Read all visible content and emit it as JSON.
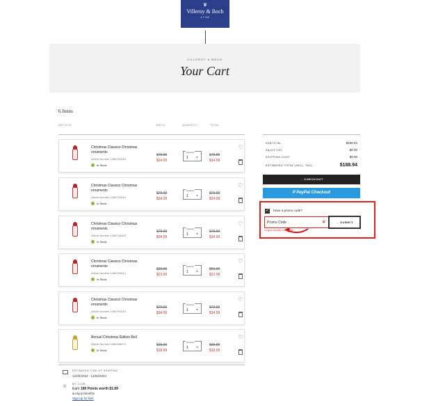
{
  "header": {
    "logo_top": "♛",
    "logo_name": "Villeroy & Boch",
    "logo_year": "1748",
    "hero_brand": "VILLEROY & BOCH",
    "hero_title": "Your Cart"
  },
  "cart": {
    "items_count": "6 Items",
    "columns": {
      "article": "ARTICLE",
      "each": "EACH",
      "quantity": "QUANTITY",
      "total": "TOTAL"
    },
    "qty_label": "Quantity",
    "items": [
      {
        "title": "Christmas Classics Christmas ornaments",
        "article": "Article Number 1486794340",
        "stock": "In Stock",
        "each_orig": "$79.99",
        "each_sale": "$34.99",
        "qty": "1",
        "total_orig": "$79.99",
        "total_sale": "$34.99"
      },
      {
        "title": "Christmas Classics Christmas ornaments",
        "article": "Article Number 1486794344",
        "stock": "In Stock",
        "each_orig": "$79.99",
        "each_sale": "$34.99",
        "qty": "1",
        "total_orig": "$79.99",
        "total_sale": "$34.99"
      },
      {
        "title": "Christmas Classics Christmas ornaments",
        "article": "Article Number 1486794343",
        "stock": "In Stock",
        "each_orig": "$79.99",
        "each_sale": "$34.99",
        "qty": "1",
        "total_orig": "$79.99",
        "total_sale": "$34.99"
      },
      {
        "title": "Christmas Classics Christmas ornaments",
        "article": "Article Number 1486794344",
        "stock": "In Stock",
        "each_orig": "$69.99",
        "each_sale": "$23.99",
        "qty": "1",
        "total_orig": "$69.99",
        "total_sale": "$23.99"
      },
      {
        "title": "Christmas Classics Christmas ornaments",
        "article": "Article Number 1486794344",
        "stock": "In Stock",
        "each_orig": "$79.99",
        "each_sale": "$34.99",
        "qty": "1",
        "total_orig": "$79.99",
        "total_sale": "$34.99"
      },
      {
        "title": "Annual Christmas Edition Bell",
        "article": "Article Number 1486266873",
        "stock": "In Stock",
        "each_orig": "$39.99",
        "each_sale": "$18.99",
        "qty": "1",
        "total_orig": "$39.99",
        "total_sale": "$18.99"
      }
    ]
  },
  "shipping": {
    "label": "ESTIMATED TIME OF SHIPPING",
    "dates": "12/02/2024 - 12/04/2024"
  },
  "club": {
    "label": "MY CLUB",
    "earn_prefix": "Earn ",
    "earn_bold": "189 Points worth $1.89",
    "enjoy": "& enjoy benefits",
    "signup": "Sign up for free"
  },
  "summary": {
    "rows": [
      {
        "label": "SUBTOTAL",
        "value": "$188.94"
      },
      {
        "label": "SALES TAX",
        "value": "$0.00"
      },
      {
        "label": "SHIPPING COST",
        "value": "$0.00"
      },
      {
        "label": "ESTIMATED TOTAL (INCL. TAX)",
        "value": "$188.94"
      }
    ],
    "checkout": "→   CHECKOUT",
    "paypal": "P PayPal Checkout"
  },
  "promo": {
    "question": "Have a promo code?",
    "placeholder": "Promo Code",
    "clear": "✕",
    "submit": "→   SUBMIT",
    "error": "Coupon already redeemed"
  },
  "colors": {
    "brand": "#2b3e8a",
    "sale": "#c0392b",
    "paypal": "#2a9ae0",
    "stock": "#8bb73a",
    "highlight": "#e02020"
  }
}
